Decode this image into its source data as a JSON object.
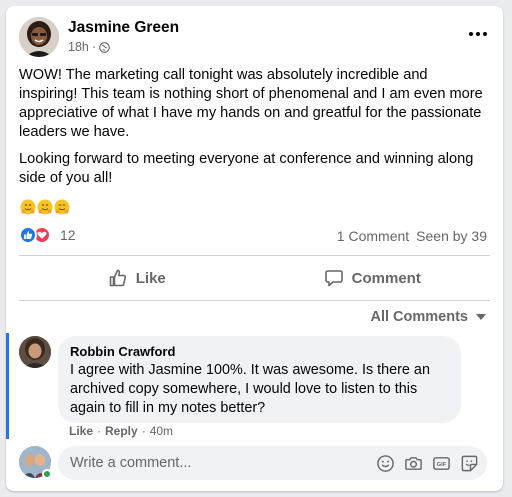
{
  "post": {
    "author": "Jasmine Green",
    "time": "18h",
    "separator": "·",
    "paragraph1": "WOW! The marketing call tonight was absolutely incredible and inspiring! This team is nothing short of phenomenal and I am even more appreciative of what I have my hands on and greatful for the passionate leaders we have.",
    "paragraph2": "Looking forward to meeting everyone at conference and winning along side of you all!",
    "emojis": [
      "hugging-face",
      "hugging-face",
      "hugging-face"
    ]
  },
  "stats": {
    "reaction_types": [
      "like",
      "love"
    ],
    "reaction_count": "12",
    "comments": "1 Comment",
    "seen_by": "Seen by 39"
  },
  "actions": {
    "like_label": "Like",
    "comment_label": "Comment"
  },
  "comments_section": {
    "filter_label": "All Comments",
    "comment": {
      "author": "Robbin Crawford",
      "text": "I agree with Jasmine 100%. It was awesome. Is there an archived copy somewhere, I would love to listen to this again to fill in my notes better?",
      "like": "Like",
      "dot1": "·",
      "reply": "Reply",
      "dot2": "·",
      "time": "40m"
    }
  },
  "composer": {
    "placeholder": "Write a comment...",
    "icons": [
      "emoji-icon",
      "camera-icon",
      "gif-icon",
      "sticker-icon"
    ]
  },
  "colors": {
    "accent": "#1877f2",
    "love": "#f33e58",
    "online": "#31a24c",
    "muted_text": "#65676b"
  }
}
